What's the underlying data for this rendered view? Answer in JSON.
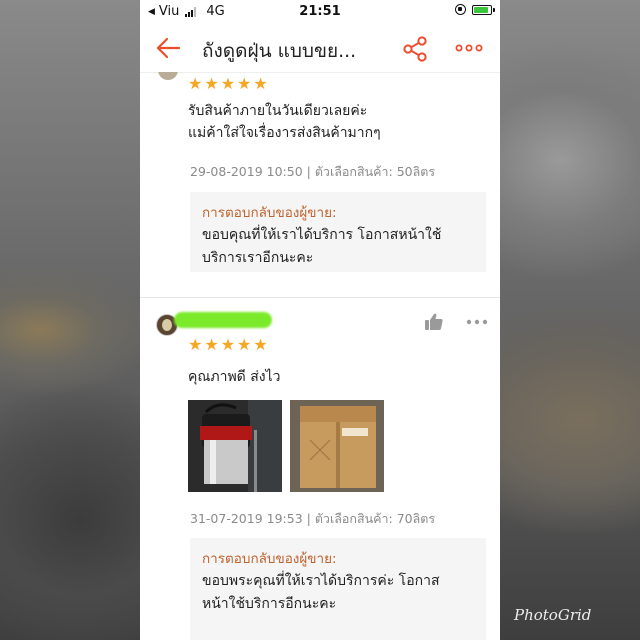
{
  "status_bar": {
    "carrier": "Viu",
    "network": "4G",
    "time": "21:51"
  },
  "header": {
    "title": "ถังดูดฝุ่น แบบขย...",
    "icons": [
      "back-arrow-icon",
      "share-icon",
      "more-options-icon"
    ],
    "accent_color": "#ee4d2d"
  },
  "reviews": [
    {
      "stars": 5,
      "text_lines": [
        "รับสินค้าภายในวันเดียวเลยค่ะ",
        "แม่ค้าใส่ใจเรื่องารส่งสินค้ามากๆ"
      ],
      "date": "29-08-2019 10:50",
      "variation": "ตัวเลือกสินค้า: 50ลิตร",
      "reply_title": "การตอบกลับของผู้ขาย:",
      "reply_lines": [
        "ขอบคุณที่ให้เราได้บริการ โอกาสหน้าใช้",
        "บริการเราอีกนะคะ"
      ]
    },
    {
      "stars": 5,
      "text": "คุณภาพดี ส่งไว",
      "photos": [
        "vacuum-cleaner-photo",
        "product-box-photo"
      ],
      "date": "31-07-2019 19:53",
      "variation": "ตัวเลือกสินค้า: 70ลิตร",
      "reply_title": "การตอบกลับของผู้ขาย:",
      "reply_lines": [
        "ขอบพระคุณที่ให้เราได้บริการค่ะ โอกาส",
        "หน้าใช้บริการอีกนะคะ"
      ]
    }
  ],
  "star_color": "#f5a623",
  "watermark": "PhotoGrid"
}
